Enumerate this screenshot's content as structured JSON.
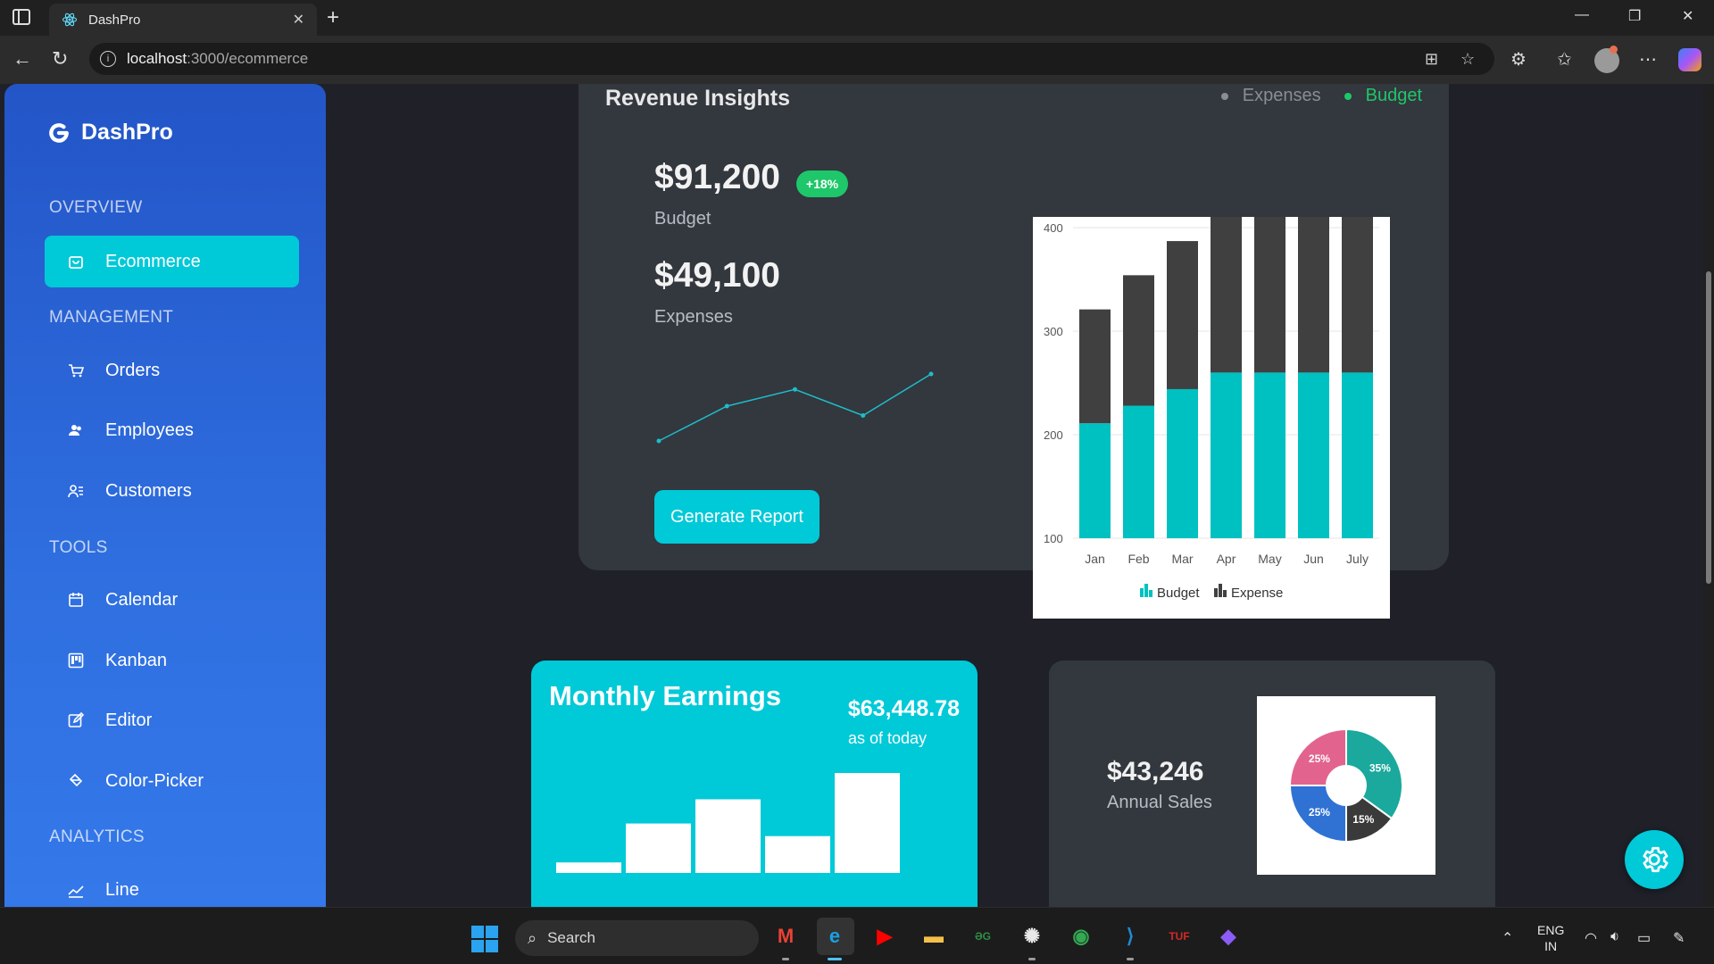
{
  "browser": {
    "tab_title": "DashPro",
    "tab_close": "✕",
    "new_tab": "+",
    "url_host": "localhost",
    "url_path": ":3000/ecommerce",
    "window_controls": {
      "minimize": "—",
      "restore": "❐",
      "close": "✕"
    }
  },
  "sidebar": {
    "app_name": "DashPro",
    "sections": [
      {
        "label": "OVERVIEW"
      },
      {
        "label": "MANAGEMENT"
      },
      {
        "label": "TOOLS"
      },
      {
        "label": "ANALYTICS"
      }
    ],
    "items": [
      {
        "label": "Ecommerce",
        "icon": "bag-icon",
        "active": true
      },
      {
        "label": "Orders",
        "icon": "cart-icon"
      },
      {
        "label": "Employees",
        "icon": "people-icon"
      },
      {
        "label": "Customers",
        "icon": "person-list-icon"
      },
      {
        "label": "Calendar",
        "icon": "calendar-icon"
      },
      {
        "label": "Kanban",
        "icon": "kanban-icon"
      },
      {
        "label": "Editor",
        "icon": "edit-icon"
      },
      {
        "label": "Color-Picker",
        "icon": "paint-bucket-icon"
      },
      {
        "label": "Line",
        "icon": "line-chart-icon"
      }
    ]
  },
  "revenue": {
    "title": "Revenue Insights",
    "legend": [
      {
        "label": "Expenses",
        "color": "#8a8d93"
      },
      {
        "label": "Budget",
        "color": "#1ec769"
      }
    ],
    "budget_value": "$91,200",
    "budget_badge": "+18%",
    "budget_label": "Budget",
    "expenses_value": "$49,100",
    "expenses_label": "Expenses",
    "button_label": "Generate Report",
    "sparkline": [
      0.0,
      0.52,
      0.77,
      0.38,
      1.0
    ]
  },
  "chart_data": [
    {
      "type": "bar",
      "stacked": true,
      "categories": [
        "Jan",
        "Feb",
        "Mar",
        "Apr",
        "May",
        "Jun",
        "July"
      ],
      "series": [
        {
          "name": "Budget",
          "color": "#00c1c1",
          "values": [
            111,
            128,
            144,
            160,
            160,
            160,
            160
          ]
        },
        {
          "name": "Expense",
          "color": "#404040",
          "values": [
            110,
            126,
            143,
            160,
            160,
            160,
            160
          ]
        }
      ],
      "ylim": [
        100,
        400
      ],
      "yticks": [
        100,
        200,
        300,
        400
      ],
      "grid": true,
      "legend": "bottom"
    },
    {
      "type": "bar",
      "values": [
        10,
        47,
        70,
        35,
        95
      ],
      "color": "#ffffff"
    },
    {
      "type": "pie",
      "donut": true,
      "slices": [
        {
          "label": "35%",
          "value": 35,
          "color": "#1aa99c"
        },
        {
          "label": "15%",
          "value": 15,
          "color": "#3a3a3a"
        },
        {
          "label": "25%",
          "value": 25,
          "color": "#2f72d4"
        },
        {
          "label": "25%",
          "value": 25,
          "color": "#e2648e"
        }
      ]
    }
  ],
  "earnings": {
    "title": "Monthly Earnings",
    "value": "$63,448.78",
    "subtitle": "as of today"
  },
  "sales": {
    "value": "$43,246",
    "label": "Annual Sales"
  },
  "taskbar": {
    "search_placeholder": "Search",
    "lang_line1": "ENG",
    "lang_line2": "IN",
    "apps": [
      {
        "name": "gmail",
        "glyph": "M",
        "color": "#e94235"
      },
      {
        "name": "edge",
        "glyph": "e",
        "color": "#1aa0e6"
      },
      {
        "name": "youtube",
        "glyph": "▶",
        "color": "#ff0000"
      },
      {
        "name": "files",
        "glyph": "▬",
        "color": "#f3c04b"
      },
      {
        "name": "geeksforgeeks",
        "glyph": "ƏG",
        "color": "#2f8d46"
      },
      {
        "name": "chatgpt",
        "glyph": "✺",
        "color": "#e8e8e8"
      },
      {
        "name": "chrome",
        "glyph": "◉",
        "color": "#34a853"
      },
      {
        "name": "vscode",
        "glyph": "⟩",
        "color": "#1f8ad2"
      },
      {
        "name": "tuf",
        "glyph": "TUF",
        "color": "#d62828"
      },
      {
        "name": "copilot",
        "glyph": "◆",
        "color": "#8b5cf6"
      }
    ]
  }
}
